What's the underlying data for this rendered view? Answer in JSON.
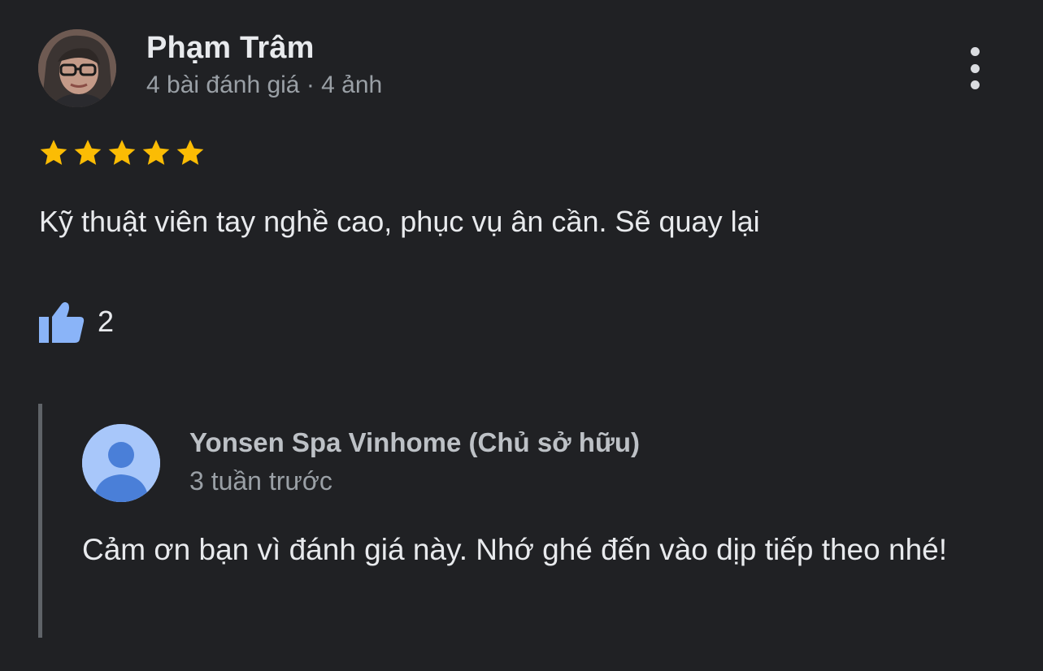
{
  "reviewer": {
    "name": "Phạm Trâm",
    "meta": "4 bài đánh giá · 4 ảnh"
  },
  "rating": {
    "stars": 5,
    "max": 5,
    "color": "#fbbc04"
  },
  "review": {
    "text": "Kỹ thuật viên tay nghề cao, phục vụ ân cần. Sẽ quay lại"
  },
  "likes": {
    "count": "2",
    "icon": "thumbs-up-icon",
    "color": "#8ab4f8"
  },
  "owner_reply": {
    "name": "Yonsen Spa Vinhome (Chủ sở hữu)",
    "time": "3 tuần trước",
    "text": "Cảm ơn bạn vì đánh giá này. Nhớ ghé đến vào dịp tiếp theo nhé!"
  },
  "theme": {
    "background": "#202124",
    "text_primary": "#e8eaed",
    "text_secondary": "#9aa0a6"
  }
}
